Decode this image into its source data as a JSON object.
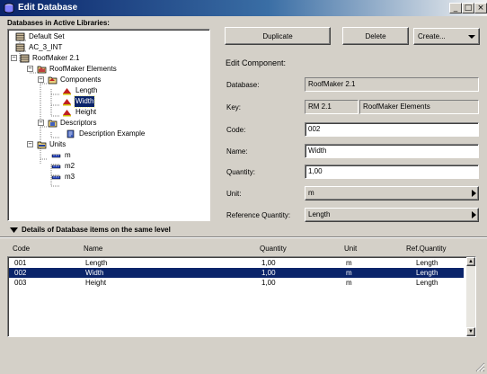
{
  "window": {
    "title": "Edit Database",
    "controls": {
      "minimize": "_",
      "maximize": "□",
      "close": "×"
    }
  },
  "left": {
    "title": "Databases in Active Libraries:",
    "tree": [
      {
        "label": "Default Set"
      },
      {
        "label": "AC_3_INT"
      },
      {
        "label": "RoofMaker 2.1"
      },
      {
        "label": "RoofMaker Elements"
      },
      {
        "label": "Components"
      },
      {
        "label": "Length"
      },
      {
        "label": "Width"
      },
      {
        "label": "Height"
      },
      {
        "label": "Descriptors"
      },
      {
        "label": "Description Example"
      },
      {
        "label": "Units"
      },
      {
        "label": "m"
      },
      {
        "label": "m2"
      },
      {
        "label": "m3"
      }
    ]
  },
  "right": {
    "duplicate": "Duplicate",
    "delete": "Delete",
    "create": "Create...",
    "section": "Edit Component:",
    "database_label": "Database:",
    "database_value": "RoofMaker 2.1",
    "key_label": "Key:",
    "key_value1": "RM 2.1",
    "key_value2": "RoofMaker Elements",
    "code_label": "Code:",
    "code_value": "002",
    "name_label": "Name:",
    "name_value": "Width",
    "quantity_label": "Quantity:",
    "quantity_value": "1,00",
    "unit_label": "Unit:",
    "unit_value": "m",
    "ref_label": "Reference Quantity:",
    "ref_value": "Length"
  },
  "details": {
    "title": "Details of Database items on the same level",
    "columns": [
      "Code",
      "Name",
      "Quantity",
      "Unit",
      "Ref.Quantity"
    ],
    "rows": [
      [
        "001",
        "Length",
        "1,00",
        "m",
        "Length"
      ],
      [
        "002",
        "Width",
        "1,00",
        "m",
        "Length"
      ],
      [
        "003",
        "Height",
        "1,00",
        "m",
        "Length"
      ]
    ]
  },
  "colors": {
    "selection": "#0a246a",
    "face": "#d4d0c8"
  }
}
